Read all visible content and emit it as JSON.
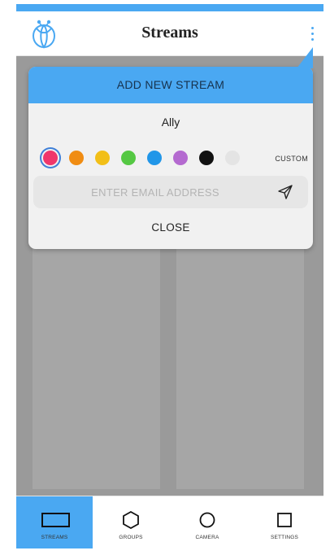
{
  "header": {
    "title": "Streams",
    "logo_icon": "hive-logo-icon",
    "menu_icon": "more-vertical-icon"
  },
  "popup": {
    "heading": "ADD NEW STREAM",
    "stream_name": "Ally",
    "colors": [
      {
        "name": "pink",
        "hex": "#f0366b",
        "selected": true
      },
      {
        "name": "orange",
        "hex": "#f08c12"
      },
      {
        "name": "yellow",
        "hex": "#f2bf18"
      },
      {
        "name": "green",
        "hex": "#55c843"
      },
      {
        "name": "blue",
        "hex": "#2196e8"
      },
      {
        "name": "purple",
        "hex": "#b46ad0"
      },
      {
        "name": "black",
        "hex": "#111111"
      },
      {
        "name": "light-gray",
        "hex": "#e4e4e4"
      }
    ],
    "custom_label": "CUSTOM",
    "email_placeholder": "ENTER EMAIL ADDRESS",
    "email_value": "",
    "send_icon": "send-icon",
    "close_label": "CLOSE"
  },
  "bottom_nav": [
    {
      "label": "STREAMS",
      "icon": "rectangle-icon",
      "active": true
    },
    {
      "label": "GROUPS",
      "icon": "hexagon-icon",
      "active": false
    },
    {
      "label": "CAMERA",
      "icon": "circle-icon",
      "active": false
    },
    {
      "label": "SETTINGS",
      "icon": "square-icon",
      "active": false
    }
  ],
  "colors": {
    "accent": "#4aa8f2",
    "overlay": "#9a9a9a",
    "popup_bg": "#f1f1f1"
  }
}
